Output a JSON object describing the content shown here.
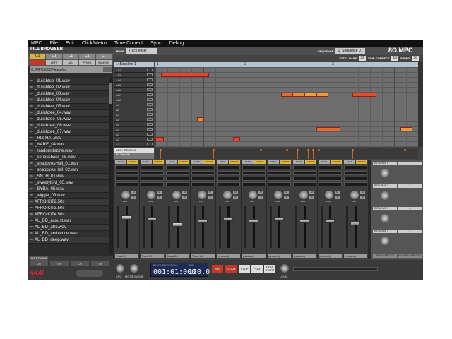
{
  "menu": [
    "MPC",
    "File",
    "Edit",
    "Click/Metro",
    "Time Correct",
    "Sync",
    "Debug"
  ],
  "file_browser": {
    "title": "FILE BROWSER",
    "tabs": [
      "C1",
      "C1",
      "C1",
      "C1",
      "C1"
    ],
    "buttons": [
      "",
      "LEFT",
      "ALL",
      "PROG",
      "SAMPLE"
    ],
    "path": "C:\\MPC5000Files\\afro",
    "files": [
      "_dulishtee_01.wav",
      "_dulishtee_02.wav",
      "_dulishtee_03.wav",
      "_dulishtee_04.wav",
      "_dulishtee_05.wav",
      "_dulishzee_04.wav",
      "_dulishzee_05.wav",
      "_dulishzee_06.wav",
      "_dulishzee_07.wav",
      "_HIZ-HAT.wav",
      "_NARE_04.wav",
      "_randomdezine.wav",
      "_seriousbass_05.wav",
      "_snappyAsHell_01.wav",
      "_snappyAsHell_02.wav",
      "_SNTH_01.wav",
      "_sweetybird_05.wav",
      "_SYBA_05.wav",
      "_wiggle_03.wav",
      "AFRO KIT2.50s",
      "AFRO KIT3.50s",
      "AFRO KIT4.50s",
      "AL_BD_acoust.wav",
      "AL_BD_afro.wav",
      "AL_BD_ambience.wav",
      "AL_BD_deep.wav"
    ],
    "edit_takes": "EDIT TAKES",
    "off_labels": [
      "Off",
      "Off",
      "Off",
      "Off"
    ],
    "brand": "AKAI",
    "brand_sub": "professional"
  },
  "topbar": {
    "mode_label": "MODE",
    "mode_value": "Track Mixer",
    "sequence_label": "SEQUENCE",
    "sequence_value": "1: Sequence 01",
    "logo": "8G MPC",
    "total_bars_label": "TOTAL BARS",
    "total_bars": "32",
    "time_correct_label": "TIME CORRECT",
    "time_correct": "16",
    "swing_label": "SWING",
    "swing": "50"
  },
  "roll": {
    "track_name": "1: Bassline 1",
    "ruler_marks": [
      "1",
      "2",
      "3"
    ],
    "keys": [
      "A12",
      "A13",
      "A14",
      "A15",
      "A16",
      "A17",
      "A10",
      "A9",
      "A8",
      "A7",
      "A6",
      "A5",
      "A4",
      "A3",
      "A2",
      "A1"
    ],
    "notes": [
      {
        "row": 1,
        "start": 0.5,
        "len": 4,
        "color": "#e8432c"
      },
      {
        "row": 5,
        "start": 10.5,
        "len": 1,
        "color": "#e86a2c"
      },
      {
        "row": 5,
        "start": 11.5,
        "len": 1,
        "color": "#f08a30"
      },
      {
        "row": 5,
        "start": 12.5,
        "len": 1,
        "color": "#f2a03a"
      },
      {
        "row": 5,
        "start": 13.5,
        "len": 1,
        "color": "#f29a36"
      },
      {
        "row": 5,
        "start": 16.5,
        "len": 2,
        "color": "#e84a2c"
      },
      {
        "row": 10,
        "start": 3.5,
        "len": 0.6,
        "color": "#f08a30"
      },
      {
        "row": 12,
        "start": 13.5,
        "len": 2,
        "color": "#e86a2c"
      },
      {
        "row": 12,
        "start": 20.5,
        "len": 1,
        "color": "#f29a36"
      },
      {
        "row": 14,
        "start": 0,
        "len": 0.7,
        "color": "#e8432c"
      },
      {
        "row": 14,
        "start": 6.5,
        "len": 0.6,
        "color": "#e8432c"
      }
    ],
    "columns": 22,
    "velocity_title": "ADD / REMOVE",
    "velocity_sub": "NT Velocity",
    "velocity_marks": [
      0.02,
      0.22,
      0.4,
      0.5,
      0.54,
      0.58,
      0.6,
      0.62,
      0.75,
      0.95
    ]
  },
  "mixer": {
    "send_labels": [
      "SEND",
      "INSERT"
    ],
    "pan_label": "PAN",
    "mute_label": "M",
    "solo_label": "S",
    "tracks": [
      "Track 01",
      "Track 02",
      "Track 03",
      "Track 04",
      "(unused)",
      "(unused)",
      "(unused)",
      "(unused)",
      "(unused)",
      "(unused)"
    ],
    "fader_levels": [
      0.25,
      0.3,
      0.45,
      0.35,
      0.3,
      0.35,
      0.3,
      0.35,
      0.35,
      0.4
    ],
    "returns": [
      "RETURNS 1",
      "RETURNS 2",
      "RETURNS 3",
      "RETURNS 4"
    ],
    "return_nums": [
      "1",
      "2",
      "3",
      "4"
    ],
    "send_effects": "SEND EFFECTS",
    "master_effects": "MASTER EFFECTS"
  },
  "transport": {
    "cpu_label": "CPU",
    "metronome_label": "METRONOME",
    "lcd_label1": "BEATS/BEATS/TICKS",
    "position": "001:01:000",
    "lcd_label2": "BPM",
    "bpm": "120.0",
    "rec": "REC",
    "overdub": "O.DUB",
    "stop": "STOP",
    "play": "PLAY",
    "play_start": "PLAY START",
    "level_label": "LEVEL"
  }
}
